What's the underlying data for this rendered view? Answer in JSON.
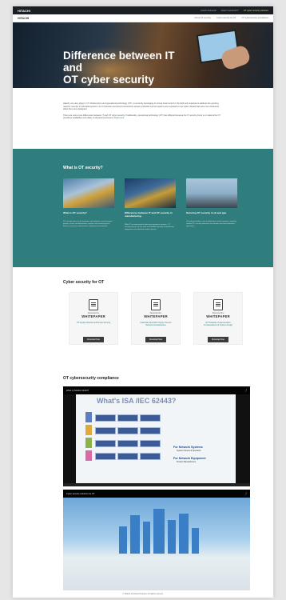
{
  "topbar": {
    "logo": "HITACHI",
    "links": [
      "Hitachi Industrial",
      "Hitachi Industrial IT",
      "OT cyber security solutions"
    ]
  },
  "navbar": {
    "logo": "HITACHI",
    "links": [
      "About OT security",
      "Cyber security for OT",
      "OT cybersecurity compliance"
    ]
  },
  "hero": {
    "title_line1": "Difference between IT and",
    "title_line2": "OT cyber security"
  },
  "intro": {
    "p1": "Hitachi, as a key player in IT infrastructure and operational technology (OT), is currently leveraging its strong track record in the field and expertise to address the growing need for security in industrial systems. As IoT devices and cloud connectivity spread, industrial control systems are exposed to new cyber threats that were not envisioned when they were designed.",
    "p2": "There are some core differences between IT and OT cyber security. Traditionally, operational technology (OT) has differed because the IT security focus is on data while OT prioritizes availability and safety of physical processes.",
    "read_more": "Read more"
  },
  "ot_section": {
    "heading": "What is OT security?",
    "cards": [
      {
        "title": "What is OT security?",
        "desc": "OT security refers to the hardware and software used to protect people, assets and information, monitor and control physical devices, processes and events in industrial environments."
      },
      {
        "title": "Differences between IT and OT security in manufacturing",
        "desc": "While IT security protects data and enterprise systems, OT security focuses on the safe and reliable operation of production equipment and industrial control systems."
      },
      {
        "title": "Securing OT security in oil and gas",
        "desc": "Oil and gas facilities rely on distributed control systems, requiring resilient OT security measures to maintain safe and continuous operations."
      }
    ]
  },
  "whitepapers": {
    "heading": "Cyber security for OT",
    "download_label": "Download the",
    "wp_label": "WHITEPAPER",
    "button": "Download Now",
    "items": [
      {
        "caption": "OT Supply Network and Device Security"
      },
      {
        "caption": "Industrial Automation System Secure Network Considerations"
      },
      {
        "caption": "IoT Hardware Implementation Considerations for System Design"
      }
    ]
  },
  "compliance": {
    "heading": "OT cybersecurity compliance",
    "video1": {
      "title": "What is ISA/IEC 62443?",
      "slide_title": "What's ISA /IEC 62443?",
      "side1": "For Network Systems",
      "side1_sub": "System Owners & Operators",
      "side2": "For Network Equipment",
      "side2_sub": "Product Manufacturers"
    },
    "video2": {
      "title": "Cyber security solutions for OT"
    }
  },
  "footer": "© Hitachi Industrial Products. All rights reserved."
}
